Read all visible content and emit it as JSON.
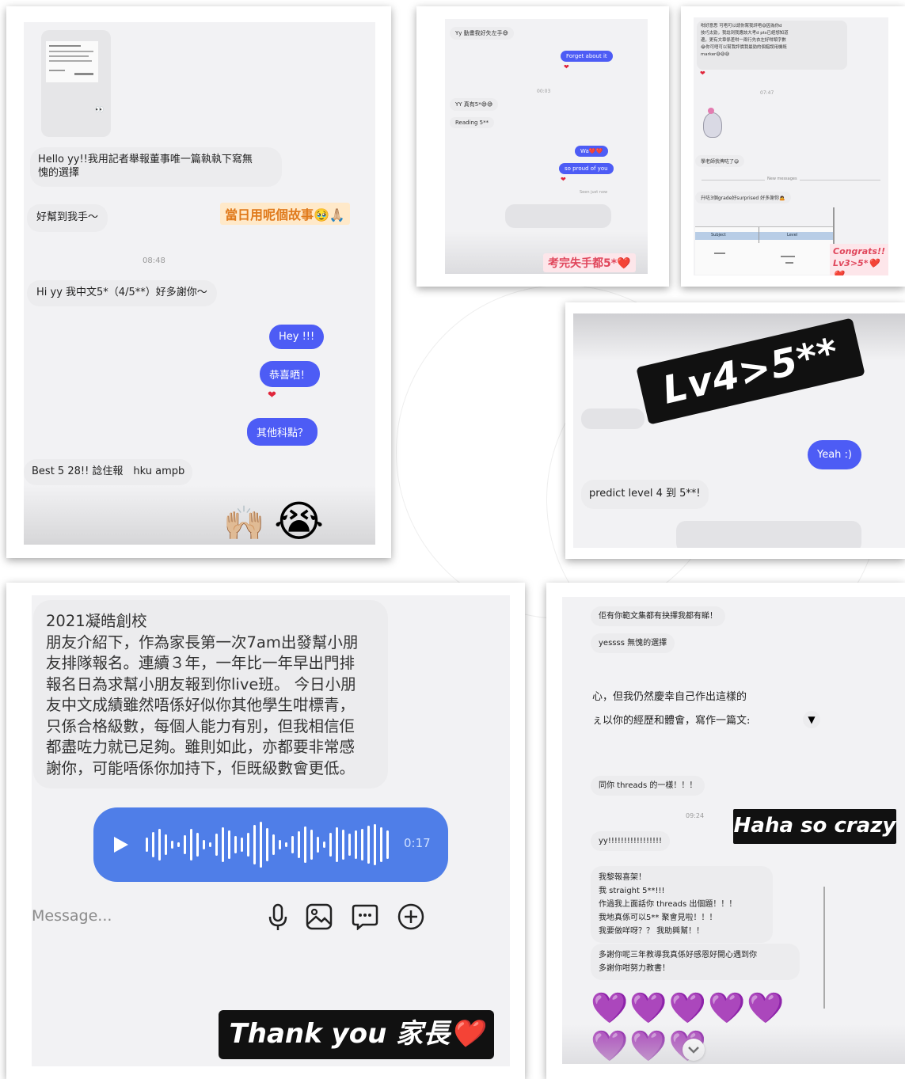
{
  "panel1": {
    "letter_lines": [
      "Hello yy!!我用記者舉報董事唯一篇執執下寫無",
      "愧的選擇"
    ],
    "msg_help": "好幫到我手～",
    "caption": "當日用呢個故事🥹🙏🏼",
    "time": "08:48",
    "msg_chinese": "Hi yy 我中文5*（4/5**）好多謝你～",
    "me_hey": "Hey !!!",
    "me_congrats": "恭喜晒！",
    "me_other": "其他科點？",
    "msg_best": "Best 5 28!! 諗住報　hku ampb",
    "emoji_hands": "🙌🏼",
    "emoji_cry": "😭"
  },
  "panel2": {
    "msg_nervous": "Yy 動畫我好失左手😅",
    "me_forget": "Forget about it",
    "time": "00:03",
    "msg_yy5": "YY 真有5*😅😅",
    "msg_reading": "Reading 5**",
    "me_wa": "Wa❤️❤️",
    "me_proud": "so proud of you",
    "seen": "Seen just now",
    "caption": "考完失手都5*❤️"
  },
  "panel3": {
    "top_lines": [
      "咁好意思 可唔可以請你幫我評唔😅因為你d",
      "技巧太勁，我諗到我應該大考d pts已經想知道",
      "邊，更有文章係差咁一兩行先衣左好咁頭字數",
      "😂你可唔可以幫我評價我最勁的個錯誤用機既",
      "marker😅😅😅"
    ],
    "time": "07:47",
    "msg_exam": "學老師我俾咗了😅",
    "new_messages": "New messages",
    "msg_upgrade": "升咗3個grade好surprised 好多謝你🙇",
    "table_headers": [
      "Subject",
      "Level"
    ],
    "caption_lines": [
      "Congrats!!",
      "Lv3>5*❤️❤️"
    ]
  },
  "panel4": {
    "sticker": "Lv4>5**",
    "me_yeah": "Yeah :)",
    "msg_predict": "predict level 4 到 5**!"
  },
  "panel5": {
    "message_lines": [
      "2021凝皓創校",
      "朋友介紹下，作為家長第一次7am出發幫小朋",
      "友排隊報名。連續３年，一年比一年早出門排",
      "報名日為求幫小朋友報到你live班。 今日小朋",
      "友中文成績雖然唔係好似你其他學生咁標青，",
      "只係合格級數，每個人能力有別，但我相信佢",
      "都盡咗力就已足夠。雖則如此，亦都要非常感",
      "謝你，可能唔係你加持下，佢既級數會更低。"
    ],
    "voice_duration": "0:17",
    "input_placeholder": "Message...",
    "caption": "Thank you 家長❤️"
  },
  "panel6": {
    "msg_essay": "佢有你範文集都有抉擇我都有睇！",
    "msg_yesss": "yessss 無愧的選擇",
    "essay_lines": [
      "心，但我仍然慶幸自己作出這樣的",
      "ぇ以你的經歷和體會，寫作一篇文:"
    ],
    "msg_threads": "同你 threads 的一樣！！！",
    "time": "09:24",
    "caption": "Haha so crazy",
    "msg_yy": "yy!!!!!!!!!!!!!!!!!",
    "long_lines": [
      "我黎報喜架！",
      "我 straight 5**!!!",
      "作過我上面話你 threads 出個題！！！",
      "我地真係可以5** 聚會見啦！！！",
      "我要做咩呀？？ 我助興幫！！"
    ],
    "thanks_lines": [
      "多謝你呢三年教導我真係好感恩好開心遇到你",
      "多謝你咁努力教書！"
    ],
    "hearts_row1": "💜💜💜💜💜",
    "hearts_row2": "💜💜💜"
  }
}
